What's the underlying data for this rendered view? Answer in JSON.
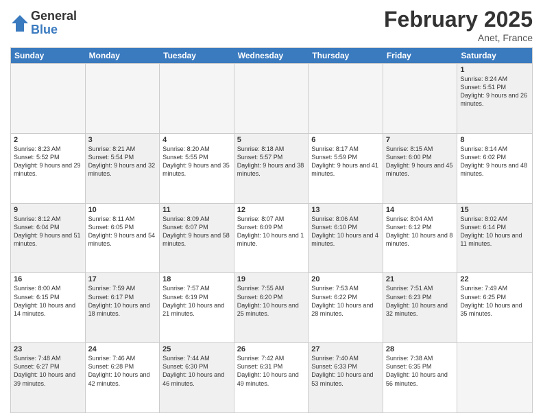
{
  "logo": {
    "general": "General",
    "blue": "Blue"
  },
  "header": {
    "month": "February 2025",
    "location": "Anet, France"
  },
  "weekdays": [
    "Sunday",
    "Monday",
    "Tuesday",
    "Wednesday",
    "Thursday",
    "Friday",
    "Saturday"
  ],
  "weeks": [
    [
      {
        "day": "",
        "detail": "",
        "empty": true
      },
      {
        "day": "",
        "detail": "",
        "empty": true
      },
      {
        "day": "",
        "detail": "",
        "empty": true
      },
      {
        "day": "",
        "detail": "",
        "empty": true
      },
      {
        "day": "",
        "detail": "",
        "empty": true
      },
      {
        "day": "",
        "detail": "",
        "empty": true
      },
      {
        "day": "1",
        "detail": "Sunrise: 8:24 AM\nSunset: 5:51 PM\nDaylight: 9 hours and 26 minutes.",
        "shaded": true
      }
    ],
    [
      {
        "day": "2",
        "detail": "Sunrise: 8:23 AM\nSunset: 5:52 PM\nDaylight: 9 hours and 29 minutes."
      },
      {
        "day": "3",
        "detail": "Sunrise: 8:21 AM\nSunset: 5:54 PM\nDaylight: 9 hours and 32 minutes.",
        "shaded": true
      },
      {
        "day": "4",
        "detail": "Sunrise: 8:20 AM\nSunset: 5:55 PM\nDaylight: 9 hours and 35 minutes."
      },
      {
        "day": "5",
        "detail": "Sunrise: 8:18 AM\nSunset: 5:57 PM\nDaylight: 9 hours and 38 minutes.",
        "shaded": true
      },
      {
        "day": "6",
        "detail": "Sunrise: 8:17 AM\nSunset: 5:59 PM\nDaylight: 9 hours and 41 minutes."
      },
      {
        "day": "7",
        "detail": "Sunrise: 8:15 AM\nSunset: 6:00 PM\nDaylight: 9 hours and 45 minutes.",
        "shaded": true
      },
      {
        "day": "8",
        "detail": "Sunrise: 8:14 AM\nSunset: 6:02 PM\nDaylight: 9 hours and 48 minutes."
      }
    ],
    [
      {
        "day": "9",
        "detail": "Sunrise: 8:12 AM\nSunset: 6:04 PM\nDaylight: 9 hours and 51 minutes.",
        "shaded": true
      },
      {
        "day": "10",
        "detail": "Sunrise: 8:11 AM\nSunset: 6:05 PM\nDaylight: 9 hours and 54 minutes."
      },
      {
        "day": "11",
        "detail": "Sunrise: 8:09 AM\nSunset: 6:07 PM\nDaylight: 9 hours and 58 minutes.",
        "shaded": true
      },
      {
        "day": "12",
        "detail": "Sunrise: 8:07 AM\nSunset: 6:09 PM\nDaylight: 10 hours and 1 minute."
      },
      {
        "day": "13",
        "detail": "Sunrise: 8:06 AM\nSunset: 6:10 PM\nDaylight: 10 hours and 4 minutes.",
        "shaded": true
      },
      {
        "day": "14",
        "detail": "Sunrise: 8:04 AM\nSunset: 6:12 PM\nDaylight: 10 hours and 8 minutes."
      },
      {
        "day": "15",
        "detail": "Sunrise: 8:02 AM\nSunset: 6:14 PM\nDaylight: 10 hours and 11 minutes.",
        "shaded": true
      }
    ],
    [
      {
        "day": "16",
        "detail": "Sunrise: 8:00 AM\nSunset: 6:15 PM\nDaylight: 10 hours and 14 minutes."
      },
      {
        "day": "17",
        "detail": "Sunrise: 7:59 AM\nSunset: 6:17 PM\nDaylight: 10 hours and 18 minutes.",
        "shaded": true
      },
      {
        "day": "18",
        "detail": "Sunrise: 7:57 AM\nSunset: 6:19 PM\nDaylight: 10 hours and 21 minutes."
      },
      {
        "day": "19",
        "detail": "Sunrise: 7:55 AM\nSunset: 6:20 PM\nDaylight: 10 hours and 25 minutes.",
        "shaded": true
      },
      {
        "day": "20",
        "detail": "Sunrise: 7:53 AM\nSunset: 6:22 PM\nDaylight: 10 hours and 28 minutes."
      },
      {
        "day": "21",
        "detail": "Sunrise: 7:51 AM\nSunset: 6:23 PM\nDaylight: 10 hours and 32 minutes.",
        "shaded": true
      },
      {
        "day": "22",
        "detail": "Sunrise: 7:49 AM\nSunset: 6:25 PM\nDaylight: 10 hours and 35 minutes."
      }
    ],
    [
      {
        "day": "23",
        "detail": "Sunrise: 7:48 AM\nSunset: 6:27 PM\nDaylight: 10 hours and 39 minutes.",
        "shaded": true
      },
      {
        "day": "24",
        "detail": "Sunrise: 7:46 AM\nSunset: 6:28 PM\nDaylight: 10 hours and 42 minutes."
      },
      {
        "day": "25",
        "detail": "Sunrise: 7:44 AM\nSunset: 6:30 PM\nDaylight: 10 hours and 46 minutes.",
        "shaded": true
      },
      {
        "day": "26",
        "detail": "Sunrise: 7:42 AM\nSunset: 6:31 PM\nDaylight: 10 hours and 49 minutes."
      },
      {
        "day": "27",
        "detail": "Sunrise: 7:40 AM\nSunset: 6:33 PM\nDaylight: 10 hours and 53 minutes.",
        "shaded": true
      },
      {
        "day": "28",
        "detail": "Sunrise: 7:38 AM\nSunset: 6:35 PM\nDaylight: 10 hours and 56 minutes."
      },
      {
        "day": "",
        "detail": "",
        "empty": true
      }
    ]
  ]
}
